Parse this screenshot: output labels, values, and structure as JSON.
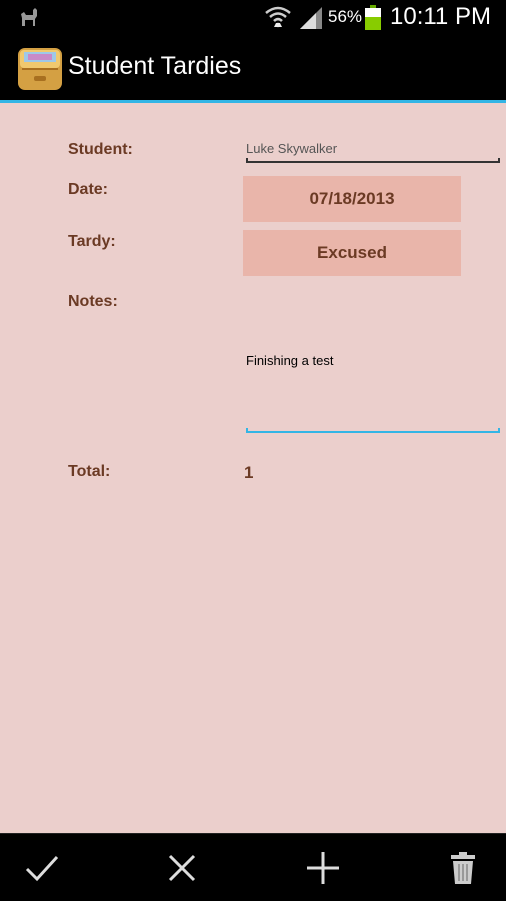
{
  "status_bar": {
    "battery_percent": "56%",
    "time": "10:11 PM",
    "icons": [
      "android-notification-icon",
      "wifi-icon",
      "signal-icon",
      "battery-icon"
    ]
  },
  "action_bar": {
    "title": "Student Tardies",
    "accent_color": "#33b5e5"
  },
  "form": {
    "student_label": "Student:",
    "student_value": "Luke Skywalker",
    "date_label": "Date:",
    "date_value": "07/18/2013",
    "tardy_label": "Tardy:",
    "tardy_value": "Excused",
    "notes_label": "Notes:",
    "notes_value": "Finishing a test",
    "total_label": "Total:",
    "total_value": "1"
  },
  "bottom_bar": {
    "actions": [
      "check-icon",
      "close-icon",
      "add-icon",
      "delete-icon"
    ]
  },
  "colors": {
    "background": "#ebcfcc",
    "button_bg": "#e9b5aa",
    "label_text": "#6b3a24"
  }
}
